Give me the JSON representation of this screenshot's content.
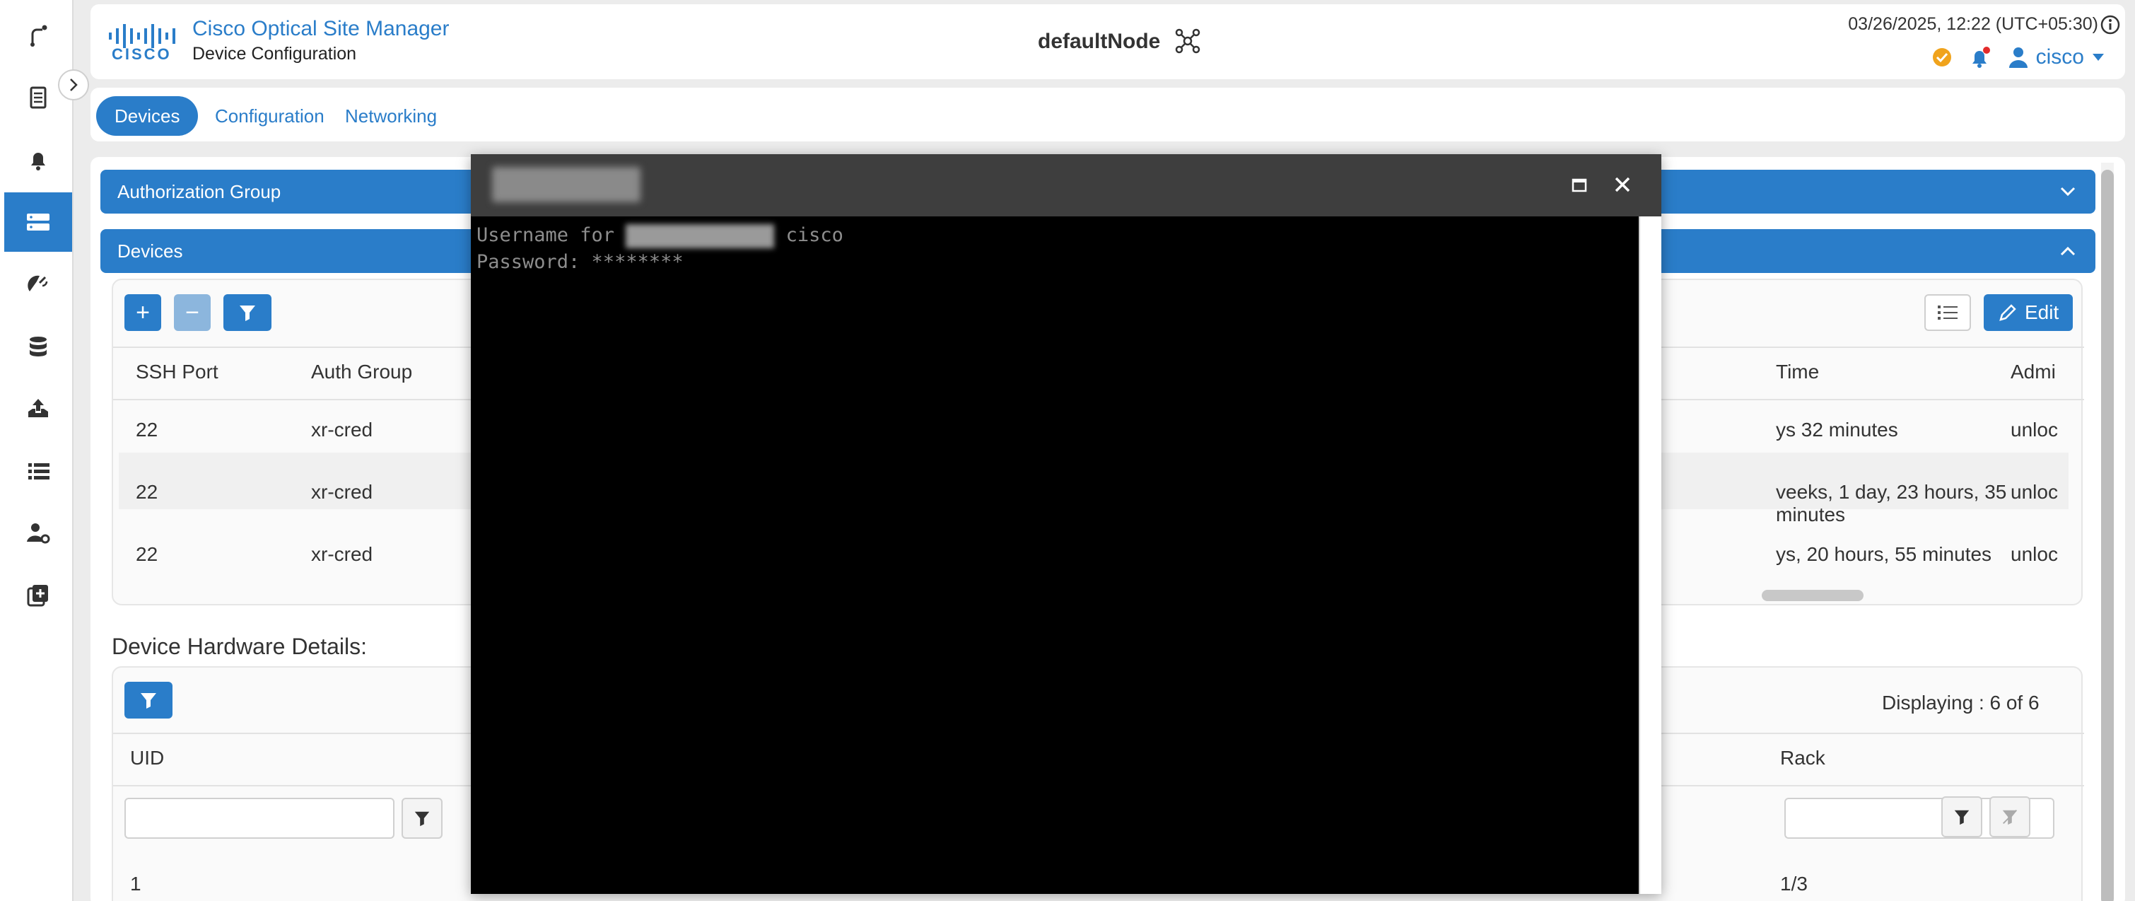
{
  "header": {
    "app_title": "Cisco Optical Site Manager",
    "subtitle": "Device Configuration",
    "logo_text": "CISCO",
    "node_name": "defaultNode",
    "datetime": "03/26/2025, 12:22 (UTC+05:30)",
    "user": "cisco"
  },
  "rail": {
    "items": [
      "route-icon",
      "document-icon",
      "bell-icon",
      "server-icon",
      "satellite-icon",
      "database-icon",
      "upload-icon",
      "list-icon",
      "user-settings-icon",
      "add-box-icon"
    ],
    "active_index": 3
  },
  "tabs": [
    {
      "label": "Devices",
      "active": true
    },
    {
      "label": "Configuration",
      "active": false
    },
    {
      "label": "Networking",
      "active": false
    }
  ],
  "accordions": {
    "auth_group": "Authorization Group",
    "devices": "Devices"
  },
  "devices_table": {
    "edit_label": "Edit",
    "columns": [
      "SSH Port",
      "Auth Group",
      "Time",
      "Admi"
    ],
    "rows": [
      {
        "ssh_port": "22",
        "auth_group": "xr-cred",
        "uptime": "ys 32 minutes",
        "admin": "unloc"
      },
      {
        "ssh_port": "22",
        "auth_group": "xr-cred",
        "uptime": "veeks, 1 day, 23 hours, 35 minutes",
        "admin": "unloc"
      },
      {
        "ssh_port": "22",
        "auth_group": "xr-cred",
        "uptime": "ys, 20 hours, 55 minutes",
        "admin": "unloc"
      }
    ]
  },
  "hardware": {
    "title": "Device Hardware Details:",
    "displaying": "Displaying : 6 of 6",
    "columns": [
      "UID",
      "Rack"
    ],
    "first_row": {
      "uid": "1",
      "rack": "1/3"
    }
  },
  "terminal": {
    "line1_prefix": "Username for ",
    "line1_suffix": " cisco",
    "line2": "Password: ********"
  },
  "colors": {
    "accent": "#2a7dc9",
    "terminal_bg": "#000000",
    "modal_bar": "#3e3e3e"
  }
}
